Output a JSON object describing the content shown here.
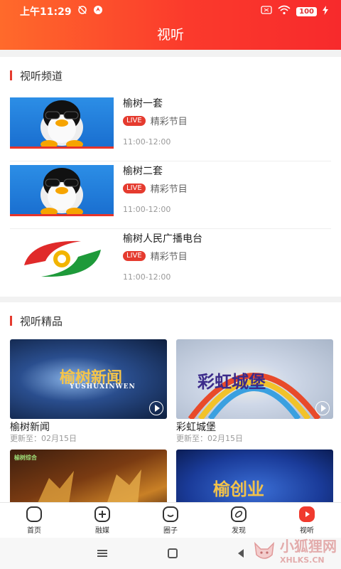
{
  "status": {
    "time": "上午11:29",
    "battery": "100"
  },
  "header": {
    "title": "视听"
  },
  "channels_section": {
    "title": "视听频道",
    "items": [
      {
        "name": "榆树一套",
        "live": "LIVE",
        "desc": "精彩节目",
        "time": "11:00-12:00"
      },
      {
        "name": "榆树二套",
        "live": "LIVE",
        "desc": "精彩节目",
        "time": "11:00-12:00"
      },
      {
        "name": "榆树人民广播电台",
        "live": "LIVE",
        "desc": "精彩节目",
        "time": "11:00-12:00"
      }
    ]
  },
  "featured_section": {
    "title": "视听精品",
    "cards": [
      {
        "title": "榆树新闻",
        "sub": "更新至：02月15日",
        "thumb_text": "榆树新闻",
        "thumb_subtext": "YUSHUXINWEN"
      },
      {
        "title": "彩虹城堡",
        "sub": "更新至：02月15日",
        "thumb_text": "彩虹城堡"
      },
      {
        "thumb_text": "榆树综合"
      },
      {
        "thumb_text": "榆创业"
      }
    ]
  },
  "bottom_nav": {
    "items": [
      {
        "label": "首页",
        "icon": "home-icon"
      },
      {
        "label": "融媒",
        "icon": "plus-icon"
      },
      {
        "label": "圈子",
        "icon": "smile-icon"
      },
      {
        "label": "发现",
        "icon": "compass-icon"
      },
      {
        "label": "视听",
        "icon": "play-icon",
        "active": true
      }
    ]
  },
  "watermark": {
    "cn": "小狐狸网",
    "en": "XHLKS.CN"
  },
  "colors": {
    "accent": "#f03a2e",
    "header_start": "#ff6a2b",
    "header_end": "#f72a2c"
  }
}
